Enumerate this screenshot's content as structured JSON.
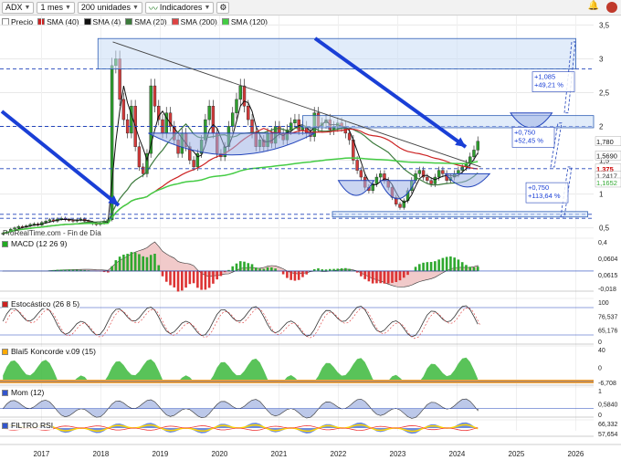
{
  "toolbar": {
    "symbol": "ADX",
    "period": "1 mes",
    "units": "200 unidades",
    "indicators": "Indicadores"
  },
  "watermark": "ProRealTime.com - Fin de Día",
  "legend": [
    {
      "label": "Precio",
      "color": "#ffffff"
    },
    {
      "label": "SMA (40)",
      "color": "#cc2222"
    },
    {
      "label": "SMA (4)",
      "color": "#111111"
    },
    {
      "label": "SMA (20)",
      "color": "#3c7a3c"
    },
    {
      "label": "SMA (200)",
      "color": "#dd4444"
    },
    {
      "label": "SMA (120)",
      "color": "#44cc44"
    }
  ],
  "price_tags": [
    {
      "label": "1,780",
      "value": 1.78,
      "bg": "#ffffff",
      "color": "#111111"
    },
    {
      "label": "1,5690",
      "value": 1.569,
      "bg": "#ffffff",
      "color": "#111111"
    },
    {
      "label": "1,375",
      "value": 1.375,
      "bg": "#ffffff",
      "color": "#cc0000"
    },
    {
      "label": "1,2417",
      "value": 1.27,
      "bg": "#ffffff",
      "color": "#333333"
    },
    {
      "label": "1,1652",
      "value": 1.17,
      "bg": "#ffffff",
      "color": "#33aa33"
    }
  ],
  "annotations": [
    {
      "label": "+1,085\n+49,21 %"
    },
    {
      "label": "+0,750\n+52,45 %"
    },
    {
      "label": "+0,750\n+113,64 %"
    }
  ],
  "indicators": [
    {
      "title": "MACD (12 26 9)",
      "color": "#22aa22",
      "axis": [
        "0,4",
        "0,0604",
        "0,0615",
        "-0,018"
      ]
    },
    {
      "title": "Estocástico (26 8 5)",
      "color": "#cc2222",
      "axis": [
        "100",
        "76,537",
        "65,176",
        "0"
      ]
    },
    {
      "title": "Blai5 Koncorde v.09 (15)",
      "color": "#ffaa00",
      "axis": [
        "40",
        "0",
        "-6,708"
      ]
    },
    {
      "title": "Mom (12)",
      "color": "#3355cc",
      "axis": [
        "1",
        "0,5840",
        "0"
      ]
    },
    {
      "title": "FILTRO RSI",
      "color": "#3355cc",
      "axis": [
        "66,332",
        "57,654"
      ]
    }
  ],
  "chart_data": {
    "type": "candlestick",
    "x_ticks": [
      "2017",
      "2018",
      "2019",
      "2020",
      "2021",
      "2022",
      "2023",
      "2024",
      "2025",
      "2026"
    ],
    "y_ticks": [
      0.5,
      1,
      1.5,
      2,
      2.5,
      3,
      3.5
    ],
    "ylim": [
      0.4,
      3.6
    ],
    "last_price": 1.78,
    "series": [
      {
        "name": "SMA (4)",
        "color": "#111111"
      },
      {
        "name": "SMA (20)",
        "color": "#3c7a3c"
      },
      {
        "name": "SMA (40)",
        "color": "#cc2222"
      },
      {
        "name": "SMA (120)",
        "color": "#44cc44"
      }
    ],
    "ohlc_monthly": [
      0.42,
      0.44,
      0.48,
      0.5,
      0.52,
      0.51,
      0.53,
      0.55,
      0.56,
      0.54,
      0.58,
      0.6,
      0.62,
      0.6,
      0.63,
      0.64,
      0.62,
      0.61,
      0.6,
      0.62,
      0.63,
      0.6,
      0.58,
      0.56,
      0.55,
      0.57,
      0.6,
      0.62,
      2.9,
      3.0,
      2.4,
      2.1,
      1.9,
      2.3,
      1.7,
      1.4,
      1.3,
      1.6,
      2.6,
      2.3,
      2.1,
      1.9,
      2.2,
      2.0,
      1.8,
      1.6,
      1.9,
      1.7,
      1.5,
      1.4,
      1.6,
      1.8,
      2.1,
      2.3,
      1.9,
      1.6,
      1.55,
      1.7,
      2.0,
      2.2,
      2.4,
      2.6,
      2.3,
      2.1,
      1.9,
      1.7,
      1.8,
      1.7,
      1.9,
      1.75,
      2.0,
      1.9,
      1.8,
      1.95,
      2.05,
      2.1,
      1.95,
      2.0,
      1.9,
      1.85,
      2.2,
      2.0,
      2.05,
      2.1,
      1.95,
      2.0,
      2.05,
      2.0,
      1.9,
      1.8,
      1.5,
      1.35,
      1.25,
      1.1,
      1.05,
      1.15,
      1.25,
      1.3,
      1.2,
      1.1,
      0.95,
      0.85,
      0.8,
      0.9,
      1.05,
      1.2,
      1.3,
      1.35,
      1.25,
      1.2,
      1.15,
      1.25,
      1.35,
      1.3,
      1.2,
      1.25,
      1.3,
      1.35,
      1.4,
      1.45,
      1.55,
      1.65,
      1.78
    ],
    "horizontal_levels": [
      2.85,
      2.0,
      1.375,
      0.7,
      0.64
    ],
    "trendline": {
      "from": [
        2018.2,
        3.25
      ],
      "to": [
        2024.4,
        1.4
      ]
    }
  }
}
